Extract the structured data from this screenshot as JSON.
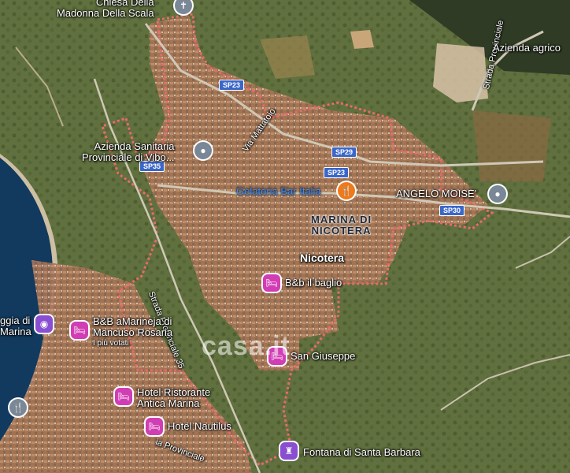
{
  "map": {
    "colors": {
      "sea": "#123a5e",
      "land": "#5d6d3f",
      "town": "#b5805e",
      "boundary": "#e86a6a"
    },
    "roads": [
      {
        "label": "SP23"
      },
      {
        "label": "SP29"
      },
      {
        "label": "SP23"
      },
      {
        "label": "SP35"
      },
      {
        "label": "SP30"
      }
    ],
    "road_names": {
      "via_mattatoio": "Via Mattatoio",
      "strada_provinciale_35": "Strada Provinciale 35",
      "strada_provinciale_right": "Strada Provinciale",
      "via_provinciale": "ia Provinciale"
    },
    "places": {
      "chiesa": "Chiesa Della Madonna Della Scala",
      "chiesa_line1": "Chiesa Della",
      "chiesa_line2": "Madonna Della Scala",
      "azienda_sanitaria_1": "Azienda Sanitaria",
      "azienda_sanitaria_2": "Provinciale di Vibo...",
      "gelateria": "Gelateria Bar Italia",
      "angelo": "ANGELO MOISE'",
      "marina_1": "MARINA DI",
      "marina_2": "NICOTERA",
      "nicotera": "Nicotera",
      "bb_baglio": "B&b il baglio",
      "bb_marineja_1": "B&B aMarineja di",
      "bb_marineja_2": "Mancuso Rosaria",
      "bb_marineja_3": "I più votati",
      "spiaggia_1": "ggia di",
      "spiaggia_2": "Marina",
      "san_giuseppe": "San Giuseppe",
      "hotel_ristorante_1": "Hotel Ristorante",
      "hotel_ristorante_2": "Antica Marina",
      "hotel_nautilus": "Hotel Nautilus",
      "fontana": "Fontana di Santa Barbara",
      "azienda_agricola": "Azienda agrico"
    },
    "watermark": "casa.it",
    "icons": {
      "poi_gray": "location-icon",
      "lodging": "bed-icon",
      "restaurant": "fork-knife-icon",
      "church": "cross-icon",
      "fountain": "fountain-icon",
      "camera": "camera-icon"
    }
  }
}
